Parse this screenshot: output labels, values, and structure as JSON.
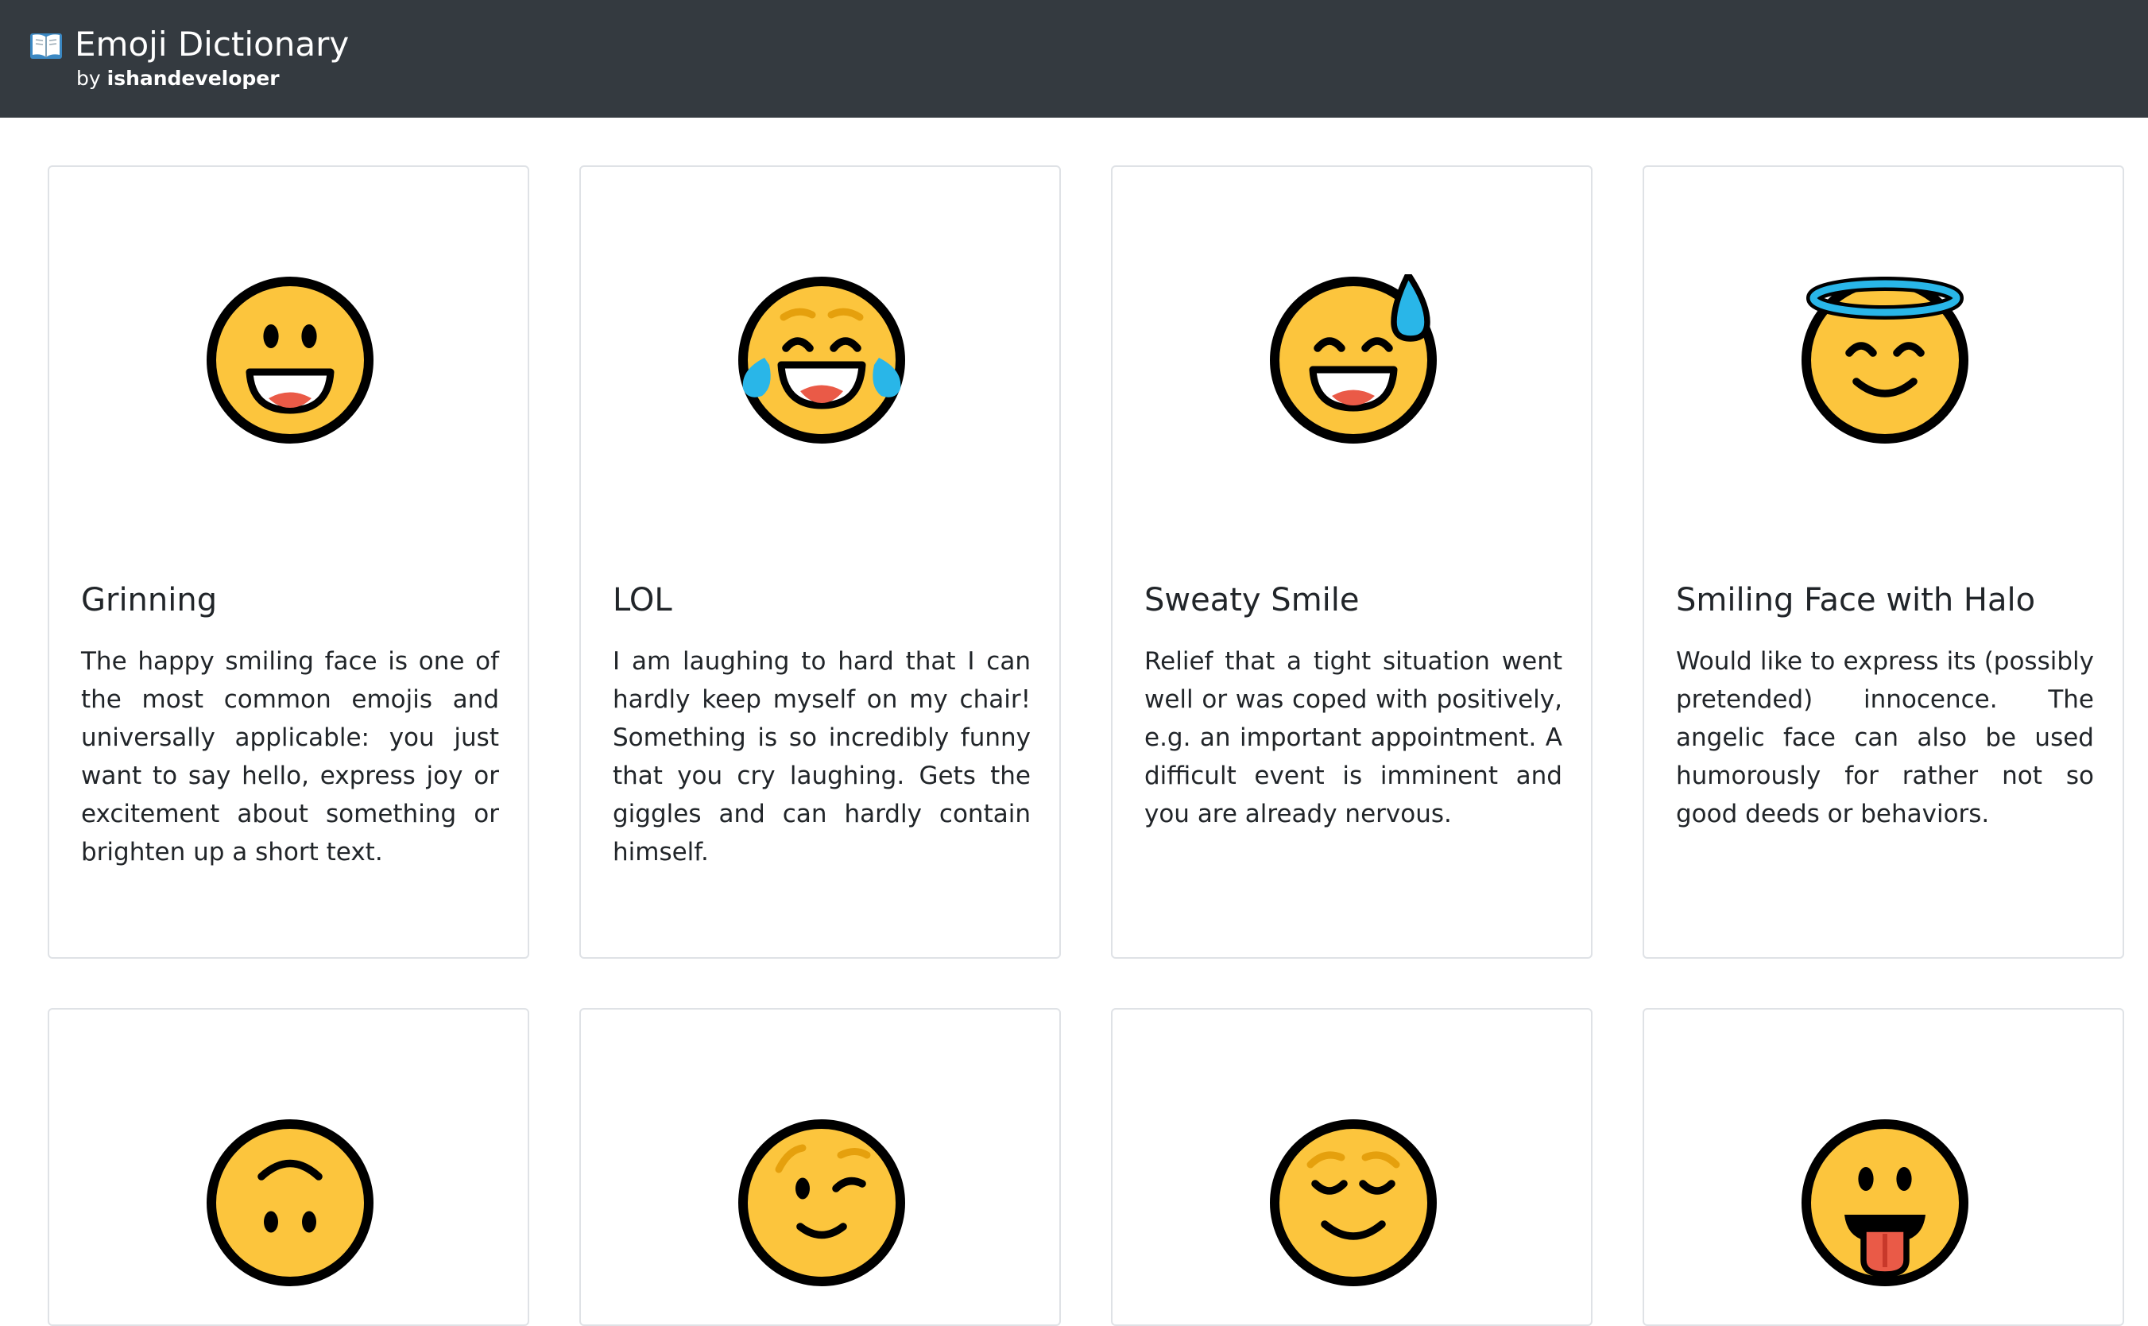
{
  "navbar": {
    "brand_icon": "open-book-icon",
    "title": "Emoji Dictionary",
    "byline_prefix": "by",
    "byline_author": "ishandeveloper"
  },
  "cards": [
    {
      "emoji_icon": "grinning-face-icon",
      "title": "Grinning",
      "text": "The happy smiling face is one of the most common emojis and universally applicable: you just want to say hello, express joy or excitement about something or brighten up a short text."
    },
    {
      "emoji_icon": "face-with-tears-of-joy-icon",
      "title": "LOL",
      "text": "I am laughing to hard that I can hardly keep myself on my chair! Something is so incredibly funny that you cry laughing. Gets the giggles and can hardly contain himself."
    },
    {
      "emoji_icon": "grinning-face-with-sweat-icon",
      "title": "Sweaty Smile",
      "text": "Relief that a tight situation went well or was coped with positively, e.g. an important appointment. A difficult event is imminent and you are already nervous."
    },
    {
      "emoji_icon": "smiling-face-with-halo-icon",
      "title": "Smiling Face with Halo",
      "text": "Would like to express its (possibly pretended) innocence. The angelic face can also be used humorously for rather not so good deeds or behaviors."
    },
    {
      "emoji_icon": "upside-down-face-icon",
      "title": "",
      "text": ""
    },
    {
      "emoji_icon": "winking-face-icon",
      "title": "",
      "text": ""
    },
    {
      "emoji_icon": "relieved-face-icon",
      "title": "",
      "text": ""
    },
    {
      "emoji_icon": "face-with-tongue-icon",
      "title": "",
      "text": ""
    }
  ],
  "colors": {
    "navbar_bg": "#343a40",
    "emoji_yellow": "#fcc53d",
    "emoji_outline": "#000000",
    "tear_blue": "#29b6e8",
    "mouth_red": "#ea5a47",
    "feature_orange": "#e5a00d"
  }
}
